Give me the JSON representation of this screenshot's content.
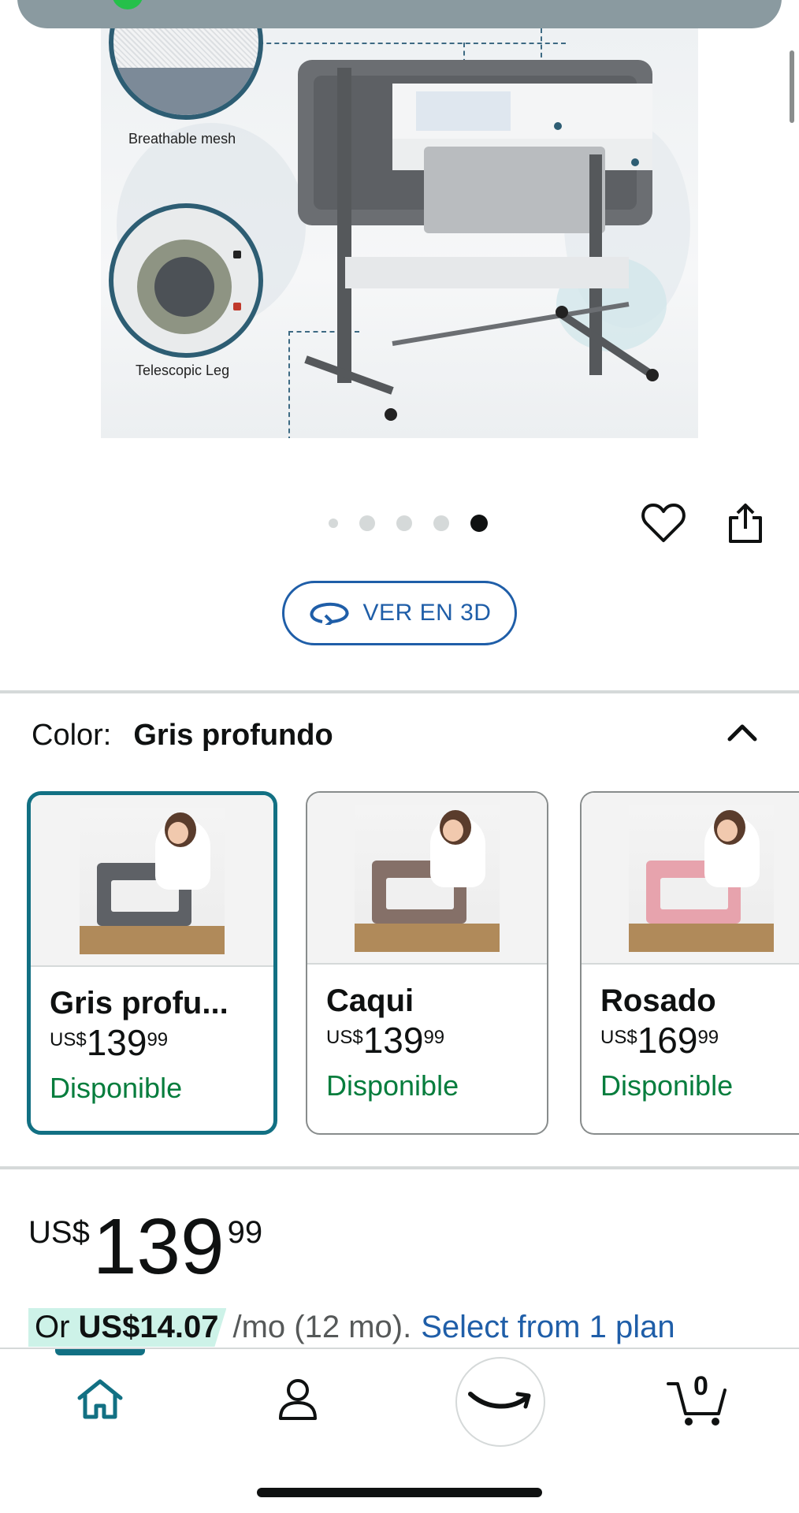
{
  "hero": {
    "callout_mesh_label": "Breathable mesh",
    "callout_leg_label": "Telescopic Leg",
    "image_count": 5,
    "active_index": 5
  },
  "actions": {
    "view_3d_label": "VER EN 3D"
  },
  "color_selector": {
    "label": "Color:",
    "selected_value": "Gris profundo",
    "options": [
      {
        "name": "Gris profu...",
        "currency": "US$",
        "price_whole": "139",
        "price_cents": "99",
        "availability": "Disponible",
        "color": "#5e6166",
        "selected": true
      },
      {
        "name": "Caqui",
        "currency": "US$",
        "price_whole": "139",
        "price_cents": "99",
        "availability": "Disponible",
        "color": "#857068",
        "selected": false
      },
      {
        "name": "Rosado",
        "currency": "US$",
        "price_whole": "169",
        "price_cents": "99",
        "availability": "Disponible",
        "color": "#e7a3ad",
        "selected": false
      }
    ]
  },
  "price": {
    "currency": "US$",
    "whole": "139",
    "cents": "99"
  },
  "installment": {
    "prefix": "Or ",
    "amount": "US$14.07",
    "term": "/mo (12 mo).",
    "link": "Select from 1 plan"
  },
  "bottom_nav": {
    "cart_count": "0",
    "active": "home"
  },
  "colors": {
    "accent_teal": "#127083",
    "link_blue": "#1f5ea8",
    "available_green": "#067d3d"
  }
}
